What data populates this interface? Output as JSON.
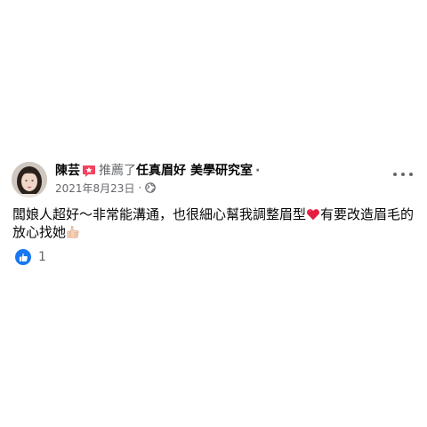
{
  "post": {
    "author": "陳芸",
    "action": "推薦了",
    "page_name_1": "任真眉好",
    "page_name_2": "美學研究室",
    "header_dot": "·",
    "date": "2021年8月23日",
    "meta_dot": "·",
    "text_part1": "闆娘人超好～非常能溝通，也很細心幫我調整眉型",
    "text_part2": "有要改造眉毛的放心找她",
    "reaction_count": "1"
  },
  "colors": {
    "brand_blue": "#1877f2",
    "recommend_red": "#f3425f",
    "secondary_text": "#65676b",
    "heart_red": "#e41e3f"
  },
  "icons": {
    "recommend": "recommend-icon",
    "globe": "globe-icon",
    "heart": "heart-icon",
    "thumb": "thumbs-up-icon",
    "like": "like-icon",
    "more": "more-icon"
  }
}
